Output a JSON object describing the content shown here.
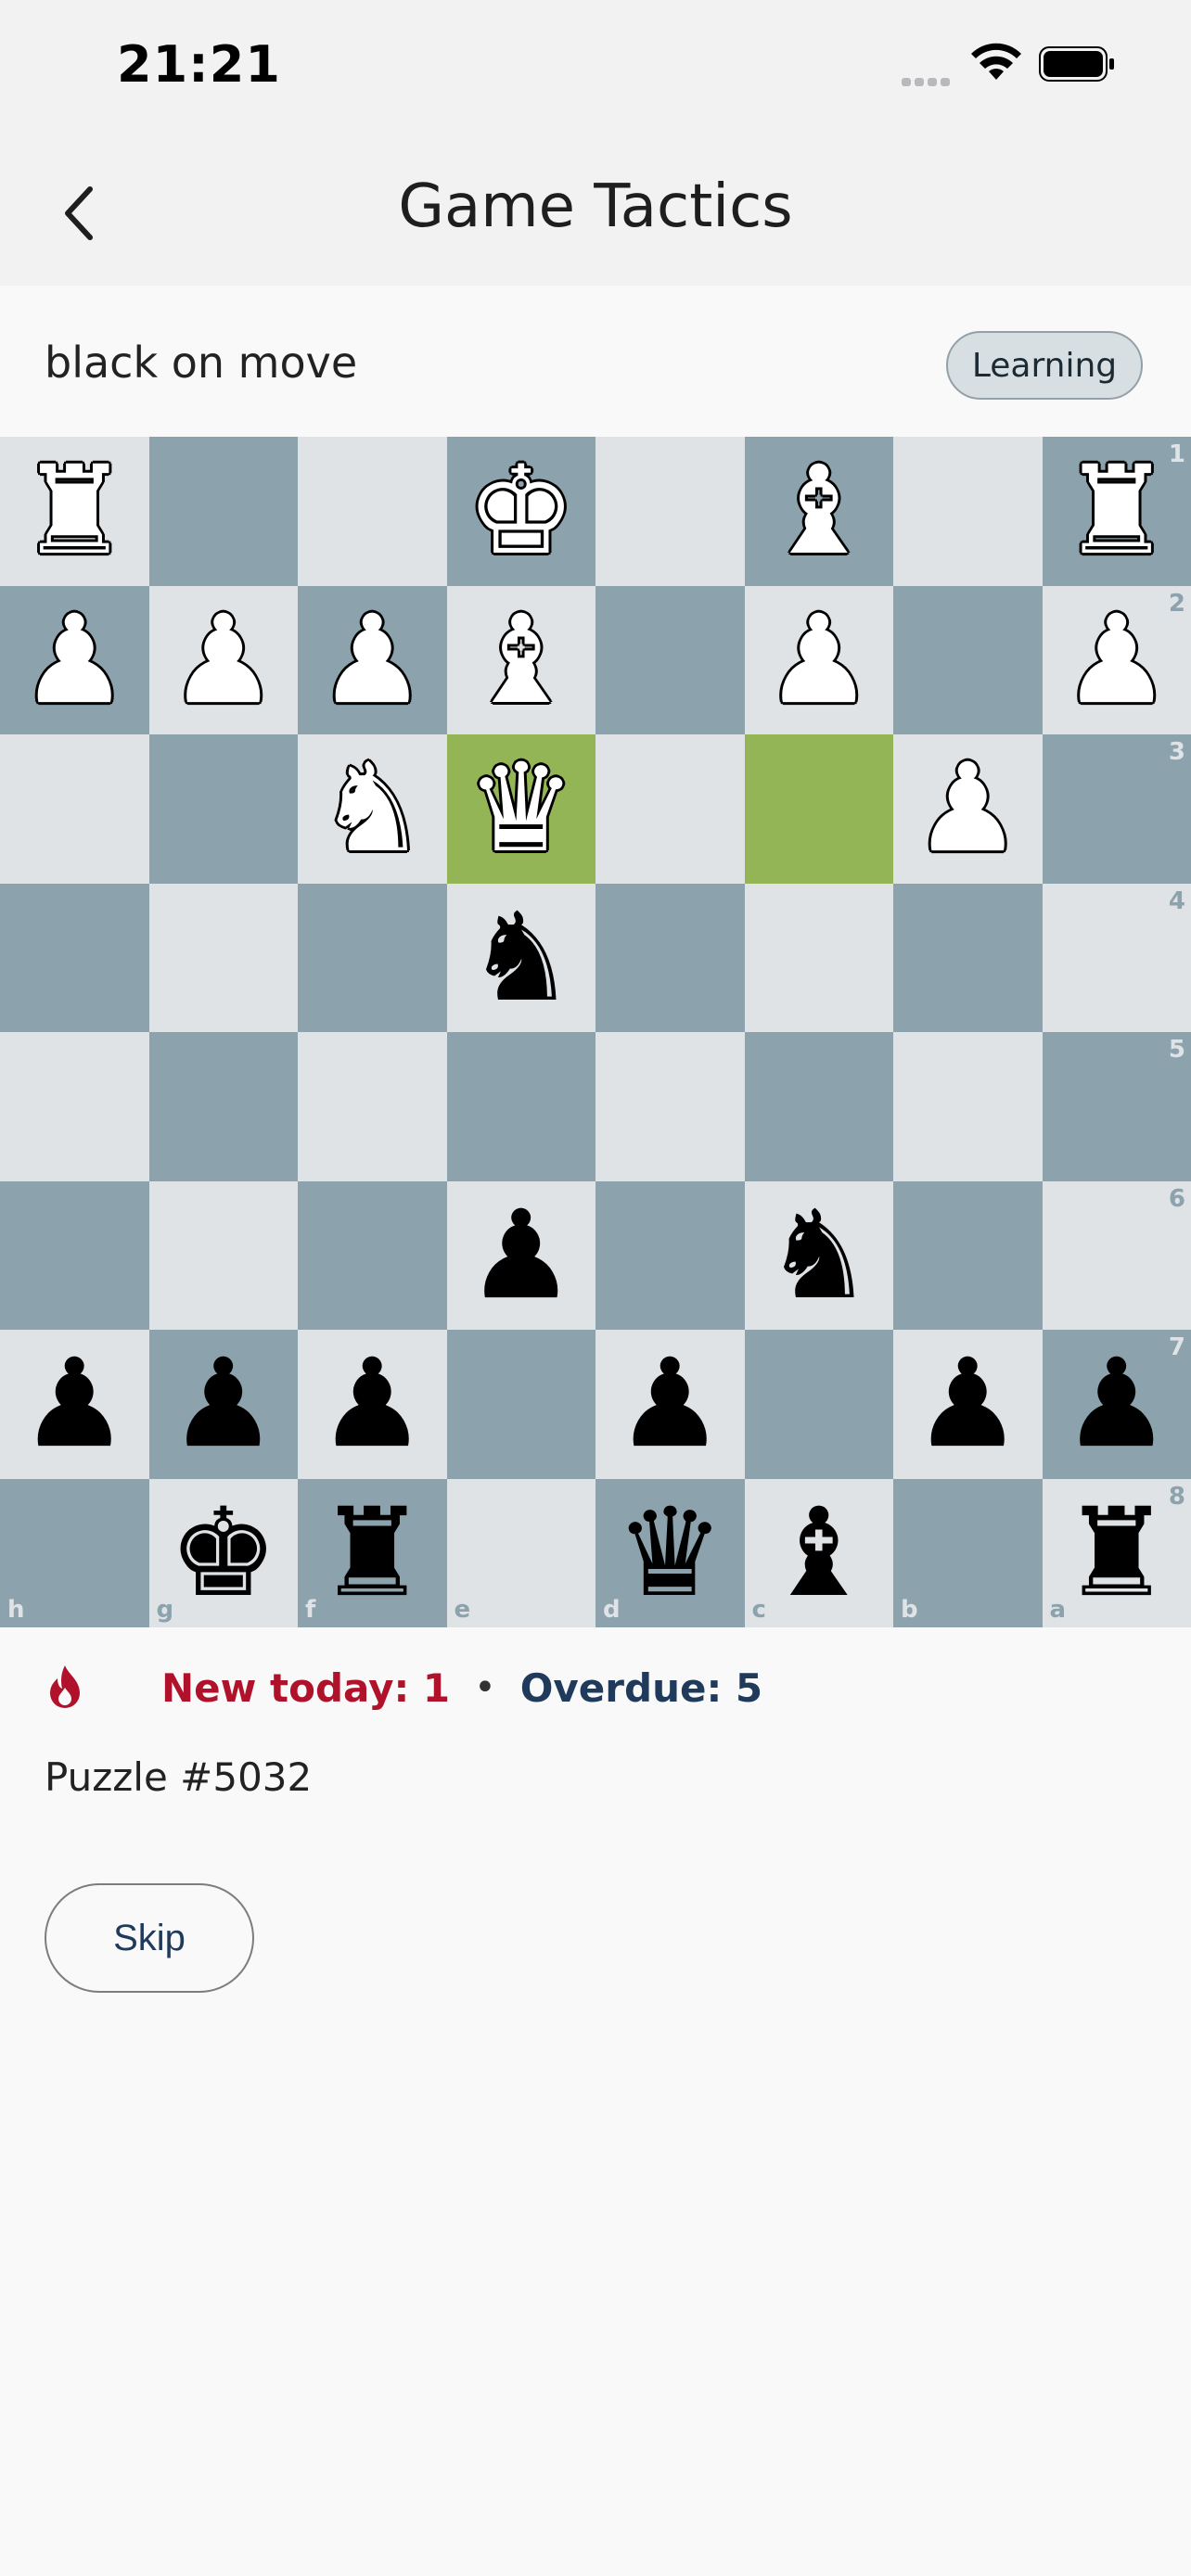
{
  "status_bar": {
    "time": "21:21"
  },
  "header": {
    "title": "Game Tactics",
    "back_icon": "chevron-left-icon"
  },
  "turn": {
    "text": "black on move",
    "badge": "Learning"
  },
  "board": {
    "orientation": "black-bottom",
    "files_display": [
      "h",
      "g",
      "f",
      "e",
      "d",
      "c",
      "b",
      "a"
    ],
    "ranks_display": [
      "1",
      "2",
      "3",
      "4",
      "5",
      "6",
      "7",
      "8"
    ],
    "highlight_squares": [
      "e3",
      "c3"
    ],
    "colors": {
      "light": "#dfe3e6",
      "dark": "#8ca2ad",
      "highlight": "#94b556"
    },
    "rows": [
      [
        "wR",
        "",
        "",
        "wK",
        "",
        "wB",
        "",
        "wR"
      ],
      [
        "wP",
        "wP",
        "wP",
        "wB",
        "",
        "wP",
        "",
        "wP"
      ],
      [
        "",
        "",
        "wN",
        "wQ",
        "",
        "",
        "wP",
        ""
      ],
      [
        "",
        "",
        "",
        "bN",
        "",
        "",
        "",
        ""
      ],
      [
        "",
        "",
        "",
        "",
        "",
        "",
        "",
        ""
      ],
      [
        "",
        "",
        "",
        "bP",
        "",
        "bN",
        "",
        ""
      ],
      [
        "bP",
        "bP",
        "bP",
        "",
        "bP",
        "",
        "bP",
        "bP"
      ],
      [
        "",
        "bK",
        "bR",
        "",
        "bQ",
        "bB",
        "",
        "bR"
      ]
    ]
  },
  "stats": {
    "new_today": "New today: 1",
    "separator": "•",
    "overdue": "Overdue: 5",
    "flame_color": "#b0122b"
  },
  "puzzle": {
    "label": "Puzzle #5032"
  },
  "actions": {
    "skip": "Skip"
  }
}
